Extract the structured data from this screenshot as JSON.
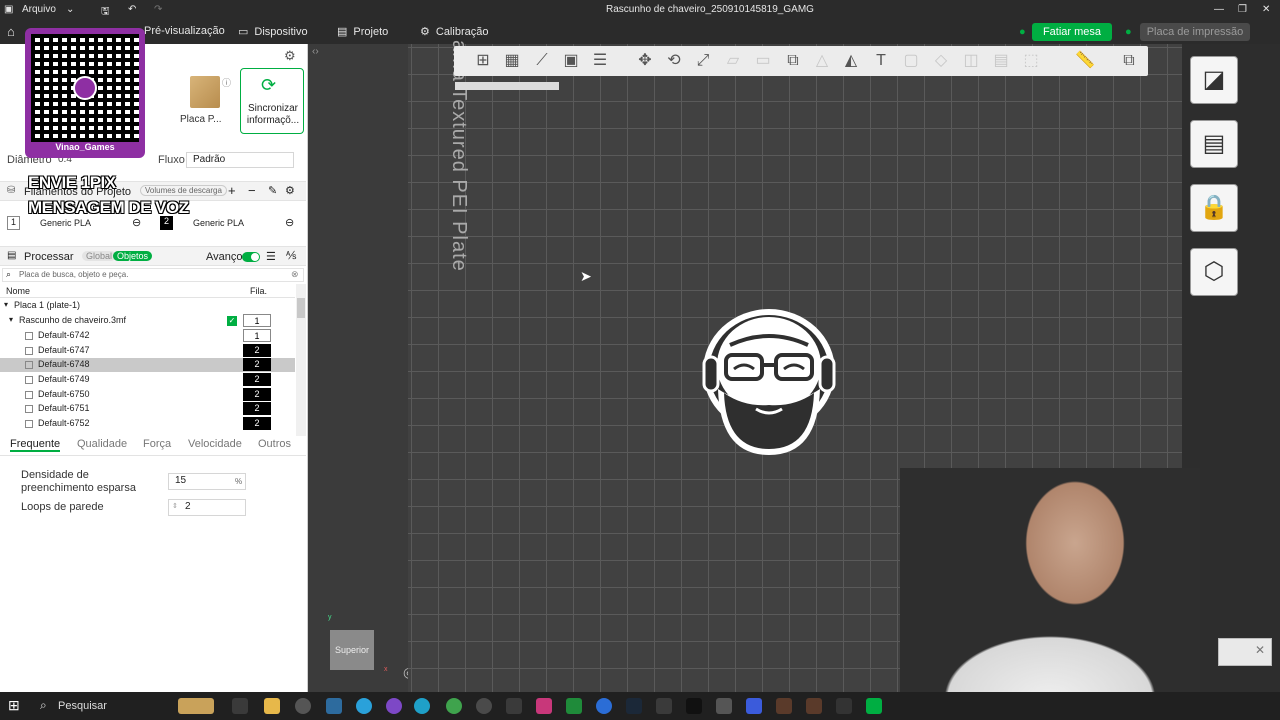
{
  "window": {
    "file_menu": "Arquivo",
    "title": "Rascunho de chaveiro_250910145819_GAMG"
  },
  "menu": {
    "preview": "Pré-visualização",
    "device": "Dispositivo",
    "project": "Projeto",
    "calibration": "Calibração",
    "slice_button": "Fatiar mesa",
    "print_button": "Placa de impressão"
  },
  "printer": {
    "plate_label": "Placa P...",
    "sync_label": "Sincronizar informaçõ...",
    "diameter_label": "Diâmetro",
    "diameter_value": "0.4",
    "flow_label": "Fluxo",
    "flow_value": "Padrão"
  },
  "filaments": {
    "header": "Filamentos do Projeto",
    "purge_button": "Volumes de descarga",
    "slots": [
      {
        "index": "1",
        "name": "Generic PLA"
      },
      {
        "index": "2",
        "name": "Generic PLA"
      }
    ]
  },
  "process": {
    "header": "Processar",
    "global_tab": "Global",
    "objects_tab": "Objetos",
    "advanced_label": "Avanço",
    "search_placeholder": "Placa de busca, objeto e peça.",
    "col_name": "Nome",
    "col_fil": "Fila."
  },
  "tree": {
    "plate": "Placa 1 (plate-1)",
    "model": "Rascunho de chaveiro.3mf",
    "model_fil": "1",
    "objects": [
      {
        "name": "Default-6742",
        "fil": "1"
      },
      {
        "name": "Default-6747",
        "fil": "2"
      },
      {
        "name": "Default-6748",
        "fil": "2"
      },
      {
        "name": "Default-6749",
        "fil": "2"
      },
      {
        "name": "Default-6750",
        "fil": "2"
      },
      {
        "name": "Default-6751",
        "fil": "2"
      },
      {
        "name": "Default-6752",
        "fil": "2"
      }
    ]
  },
  "settings_tabs": [
    "Frequente",
    "Qualidade",
    "Força",
    "Velocidade",
    "Outros"
  ],
  "settings": {
    "infill_label": "Densidade de preenchimento esparsa",
    "infill_value": "15",
    "infill_unit": "%",
    "walls_label": "Loops de parede",
    "walls_value": "2"
  },
  "viewport": {
    "plate_text": "ama Textured PEI Plate",
    "view_label": "Superior"
  },
  "overlay": {
    "qr_caption": "Vinao_Games",
    "line1": "ENVIE 1PIX",
    "line2": "MENSAGEM DE VOZ"
  },
  "taskbar": {
    "search": "Pesquisar"
  },
  "colors": {
    "accent": "#00ae42",
    "menubar": "#2b2b2b",
    "viewport": "#414141",
    "overlay_purple": "#8e2fa3"
  }
}
